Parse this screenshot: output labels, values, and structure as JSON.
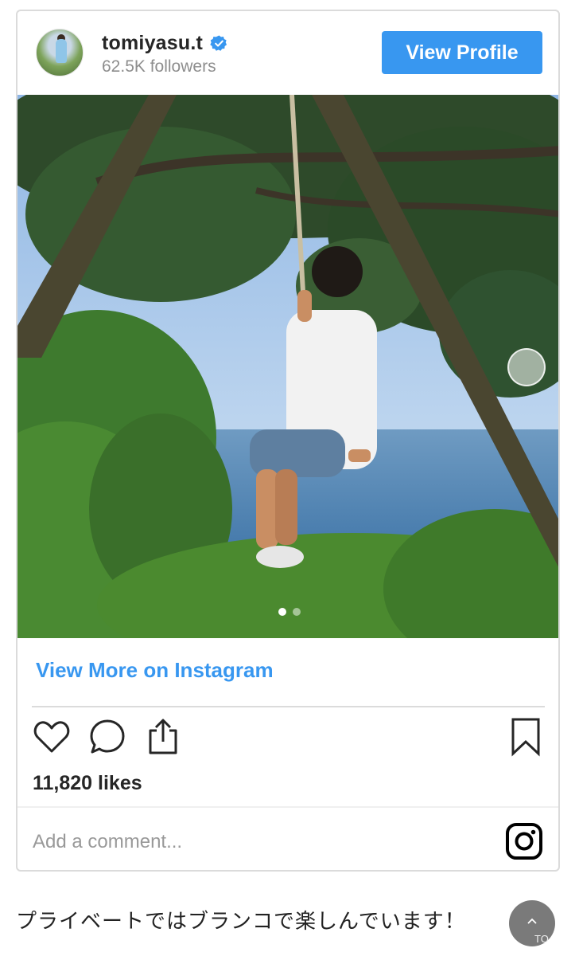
{
  "header": {
    "username": "tomiyasu.t",
    "followers": "62.5K followers",
    "view_profile_label": "View Profile"
  },
  "post": {
    "view_more_label": "View More on Instagram",
    "likes": "11,820 likes",
    "comment_placeholder": "Add a comment...",
    "carousel": {
      "total": 2,
      "active": 1
    }
  },
  "page": {
    "caption": "プライベートではブランコで楽しんでいます！",
    "to_top_label": "TO"
  },
  "colors": {
    "accent": "#3897f0",
    "border": "#dbdbdb",
    "muted": "#8e8e8e"
  },
  "icons": [
    "verified-badge-icon",
    "heart-icon",
    "comment-icon",
    "share-icon",
    "bookmark-icon",
    "instagram-logo-icon",
    "chevron-up-icon",
    "gallery-indicator-icon"
  ]
}
